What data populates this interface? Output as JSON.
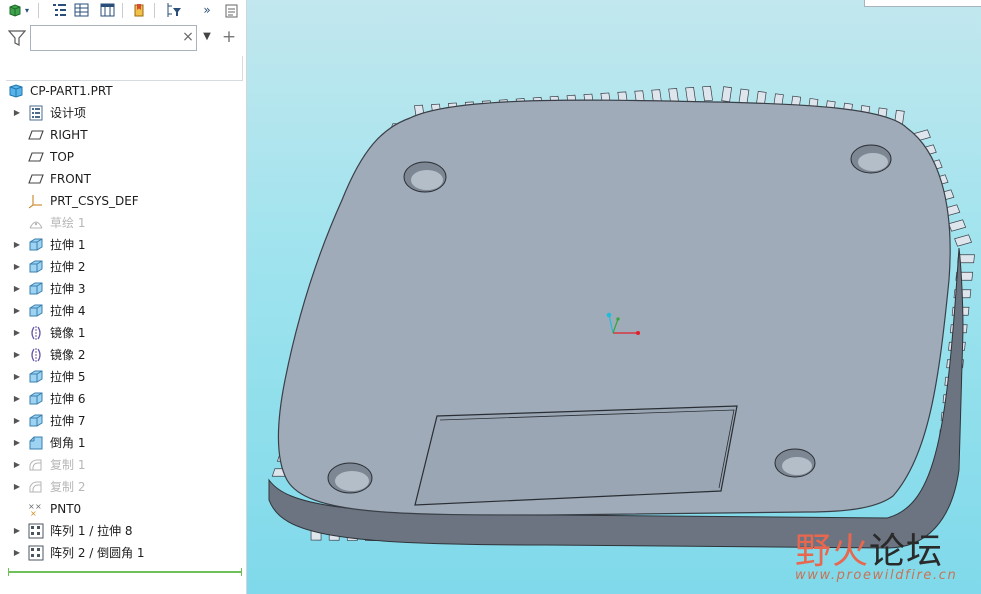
{
  "search": {
    "value": "",
    "placeholder": ""
  },
  "tree": {
    "root": "CP-PART1.PRT",
    "items": [
      {
        "label": "设计项",
        "icon": "layer-list-icon",
        "expandable": true,
        "suppressed": false
      },
      {
        "label": "RIGHT",
        "icon": "datum-plane-icon",
        "expandable": false,
        "suppressed": false
      },
      {
        "label": "TOP",
        "icon": "datum-plane-icon",
        "expandable": false,
        "suppressed": false
      },
      {
        "label": "FRONT",
        "icon": "datum-plane-icon",
        "expandable": false,
        "suppressed": false
      },
      {
        "label": "PRT_CSYS_DEF",
        "icon": "coordinate-system-icon",
        "expandable": false,
        "suppressed": false
      },
      {
        "label": "草绘 1",
        "icon": "sketch-icon",
        "expandable": false,
        "suppressed": true
      },
      {
        "label": "拉伸 1",
        "icon": "extrude-icon",
        "expandable": true,
        "suppressed": false
      },
      {
        "label": "拉伸 2",
        "icon": "extrude-icon",
        "expandable": true,
        "suppressed": false
      },
      {
        "label": "拉伸 3",
        "icon": "extrude-icon",
        "expandable": true,
        "suppressed": false
      },
      {
        "label": "拉伸 4",
        "icon": "extrude-icon",
        "expandable": true,
        "suppressed": false
      },
      {
        "label": "镜像 1",
        "icon": "mirror-icon",
        "expandable": true,
        "suppressed": false
      },
      {
        "label": "镜像 2",
        "icon": "mirror-icon",
        "expandable": true,
        "suppressed": false
      },
      {
        "label": "拉伸 5",
        "icon": "extrude-icon",
        "expandable": true,
        "suppressed": false
      },
      {
        "label": "拉伸 6",
        "icon": "extrude-icon",
        "expandable": true,
        "suppressed": false
      },
      {
        "label": "拉伸 7",
        "icon": "extrude-icon",
        "expandable": true,
        "suppressed": false
      },
      {
        "label": "倒角 1",
        "icon": "chamfer-icon",
        "expandable": true,
        "suppressed": false
      },
      {
        "label": "复制 1",
        "icon": "copy-icon",
        "expandable": true,
        "suppressed": true
      },
      {
        "label": "复制 2",
        "icon": "copy-icon",
        "expandable": true,
        "suppressed": true
      },
      {
        "label": "PNT0",
        "icon": "datum-point-icon",
        "expandable": false,
        "suppressed": false
      },
      {
        "label": "阵列 1 / 拉伸 8",
        "icon": "pattern-icon",
        "expandable": true,
        "suppressed": false
      },
      {
        "label": "阵列 2 / 倒圆角 1",
        "icon": "pattern-icon",
        "expandable": true,
        "suppressed": false
      }
    ]
  },
  "colors": {
    "part_face": "#9fabb9",
    "part_edge": "#3a3f47",
    "tooth": "#dfe5ec",
    "viewport_top": "#c2e7ee",
    "viewport_bottom": "#7fd9ea",
    "suppressed_text": "#b7b7b7",
    "insert_line": "#6fbf5b"
  },
  "watermark": {
    "cn_accent": "野火",
    "cn_rest": "论坛",
    "url": "www.proewildfire.cn"
  }
}
